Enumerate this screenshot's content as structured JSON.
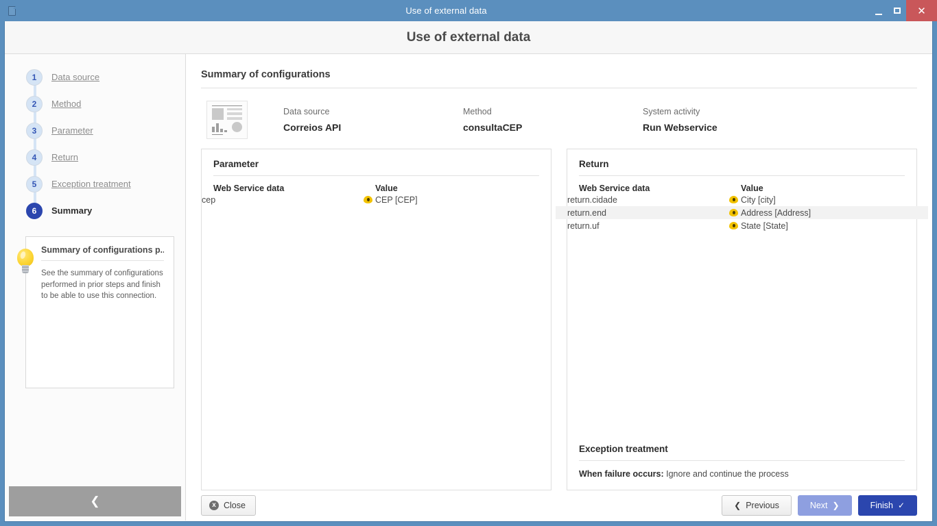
{
  "window": {
    "title": "Use of external data",
    "icon": "document-icon",
    "controls": {
      "minimize": "minimize-icon",
      "maximize": "maximize-icon",
      "close": "✕"
    }
  },
  "dialog": {
    "heading": "Use of external data"
  },
  "sidebar": {
    "steps": [
      {
        "number": "1",
        "label": "Data source",
        "active": false
      },
      {
        "number": "2",
        "label": "Method",
        "active": false
      },
      {
        "number": "3",
        "label": "Parameter",
        "active": false
      },
      {
        "number": "4",
        "label": "Return",
        "active": false
      },
      {
        "number": "5",
        "label": "Exception treatment",
        "active": false
      },
      {
        "number": "6",
        "label": "Summary",
        "active": true
      }
    ],
    "tip": {
      "icon": "lightbulb-icon",
      "title": "Summary of configurations p...",
      "text": "See the summary of configurations performed in prior steps and finish to be able to use this connection."
    },
    "collapse_icon": "❮"
  },
  "main": {
    "section_title": "Summary of configurations",
    "summary": {
      "icon": "data-source-thumbnail-icon",
      "fields": [
        {
          "label": "Data source",
          "value": "Correios API"
        },
        {
          "label": "Method",
          "value": "consultaCEP"
        },
        {
          "label": "System activity",
          "value": "Run Webservice"
        }
      ]
    },
    "parameter_panel": {
      "title": "Parameter",
      "columns": [
        "Web Service data",
        "Value"
      ],
      "rows": [
        {
          "data": "cep",
          "value": "CEP [CEP]",
          "icon": "eye-icon",
          "highlight": false
        }
      ]
    },
    "return_panel": {
      "title": "Return",
      "columns": [
        "Web Service data",
        "Value"
      ],
      "rows": [
        {
          "data": "return.cidade",
          "value": "City [city]",
          "icon": "eye-icon",
          "highlight": false
        },
        {
          "data": "return.end",
          "value": "Address [Address]",
          "icon": "eye-icon",
          "highlight": true
        },
        {
          "data": "return.uf",
          "value": "State [State]",
          "icon": "eye-icon",
          "highlight": false
        }
      ],
      "exception": {
        "title": "Exception treatment",
        "label": "When failure occurs:",
        "value": "Ignore and continue the process"
      }
    }
  },
  "footer": {
    "close": "Close",
    "previous": "Previous",
    "next": "Next",
    "finish": "Finish",
    "prev_chevron": "❮",
    "next_chevron": "❯",
    "finish_check": "✓",
    "close_icon": "x"
  },
  "colors": {
    "titlebar": "#5b8fbe",
    "close_button": "#c9575a",
    "accent": "#2b46ae",
    "step_inactive": "#d5e4f5",
    "next_disabled": "#8e9fe0",
    "eye_icon": "#f2c200",
    "row_highlight": "#f2f2f2"
  }
}
